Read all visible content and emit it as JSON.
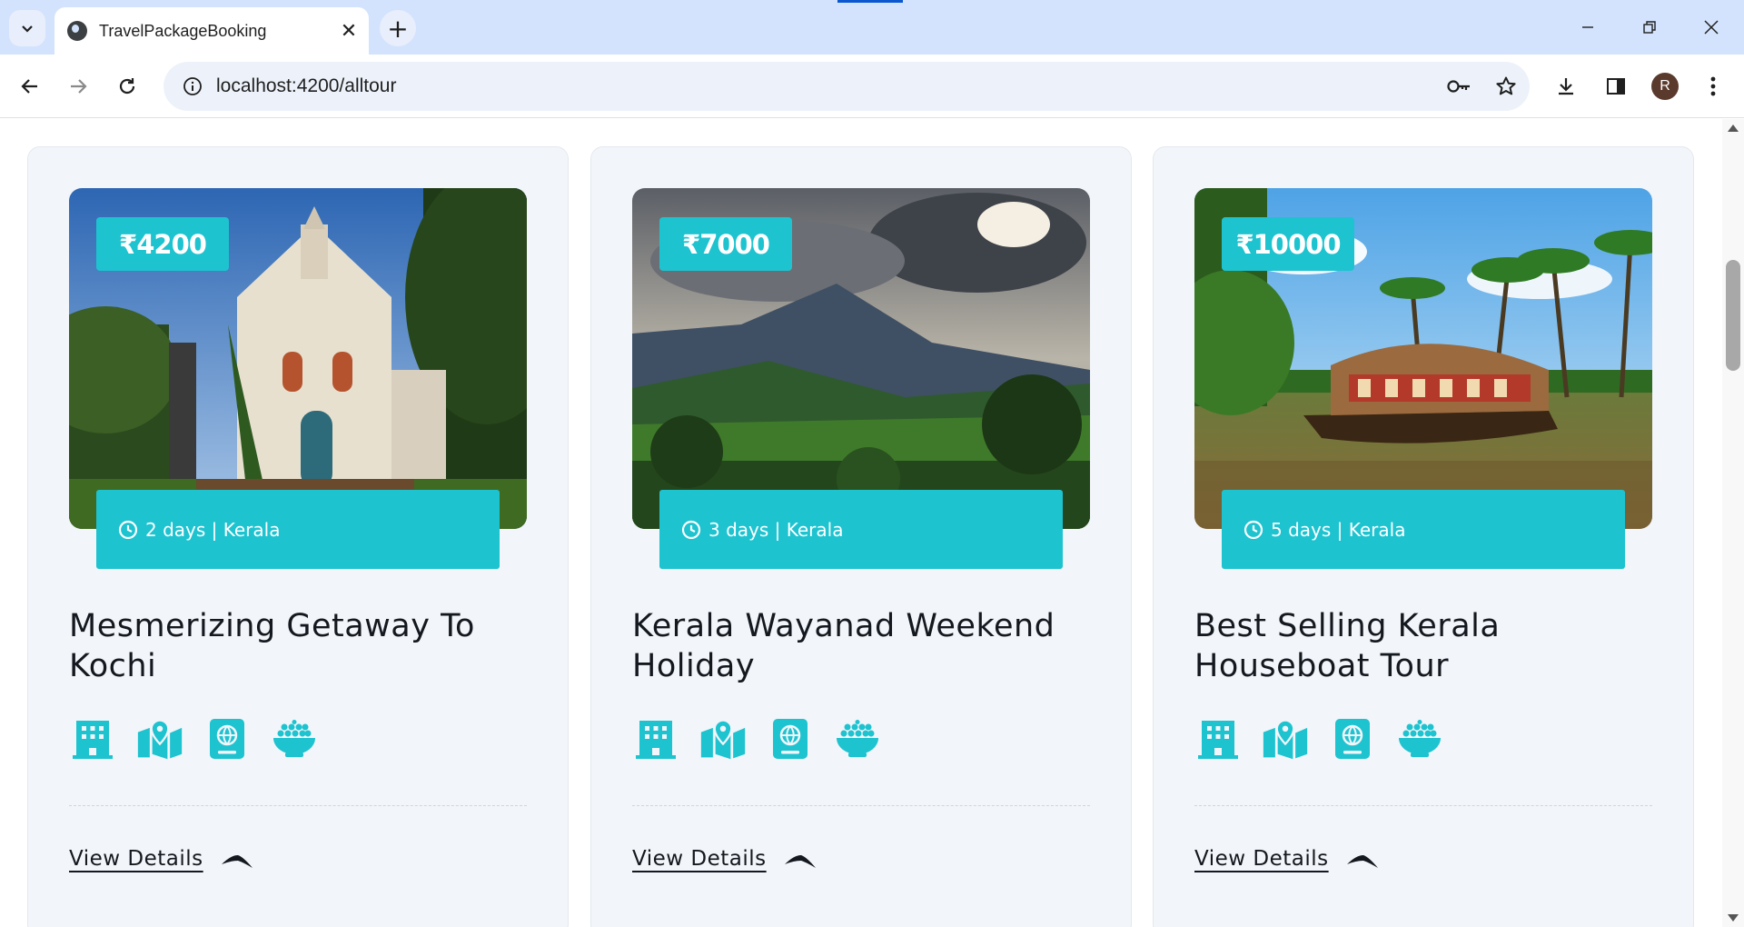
{
  "browser": {
    "tab_title": "TravelPackageBooking",
    "url": "localhost:4200/alltour",
    "profile_initial": "R",
    "icons": [
      "tab-search-icon",
      "close-icon",
      "new-tab-icon",
      "minimize-icon",
      "restore-icon",
      "window-close-icon",
      "back-icon",
      "forward-icon",
      "reload-icon",
      "site-info-icon",
      "password-key-icon",
      "bookmark-star-icon",
      "download-icon",
      "side-panel-icon",
      "more-menu-icon"
    ]
  },
  "colors": {
    "accent": "#1ec3d0",
    "card_bg": "#f2f5f9",
    "text": "#14181f"
  },
  "tours": [
    {
      "price": "₹4200",
      "duration": "2 days | Kerala",
      "title": "Mesmerizing Getaway To Kochi",
      "cta": "View Details",
      "image": "church-photo"
    },
    {
      "price": "₹7000",
      "duration": "3 days | Kerala",
      "title": "Kerala Wayanad Weekend Holiday",
      "cta": "View Details",
      "image": "mountain-photo"
    },
    {
      "price": "₹10000",
      "duration": "5 days | Kerala",
      "title": "Best Selling Kerala Houseboat Tour",
      "cta": "View Details",
      "image": "houseboat-photo"
    }
  ],
  "amenity_icons": [
    "hotel-icon",
    "map-icon",
    "passport-icon",
    "food-bowl-icon"
  ]
}
